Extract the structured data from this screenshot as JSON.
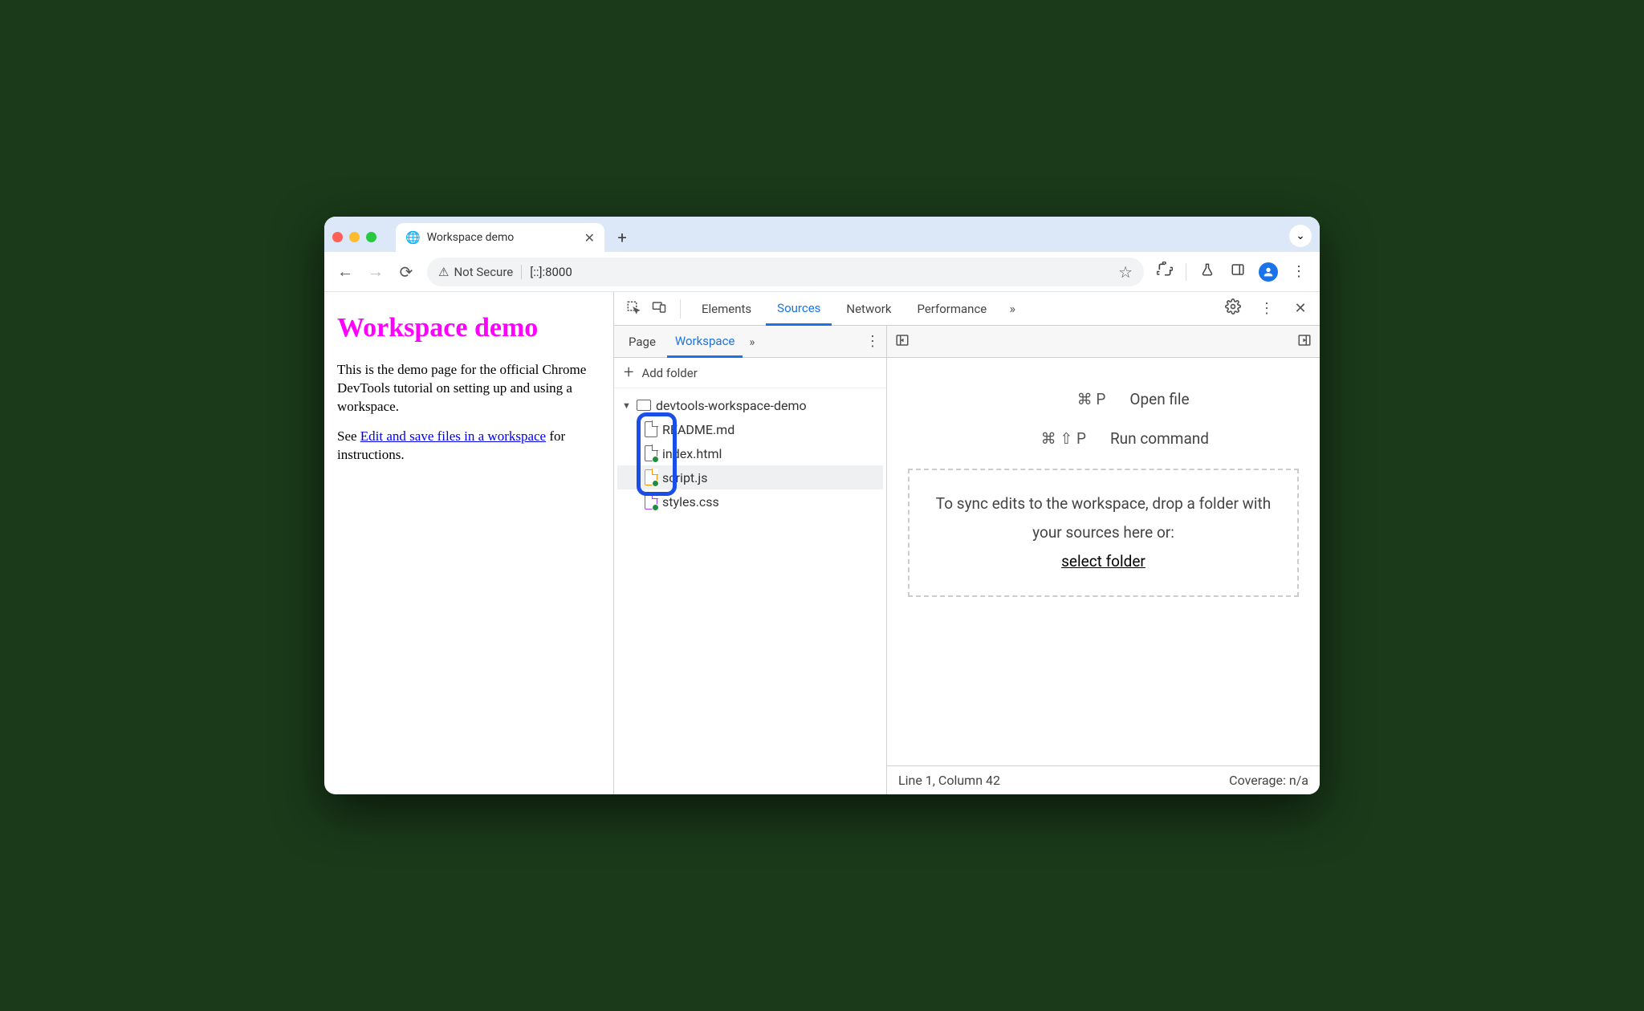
{
  "browser": {
    "tab_title": "Workspace demo",
    "url": "[::]:8000",
    "security_label": "Not Secure"
  },
  "page": {
    "heading": "Workspace demo",
    "p1": "This is the demo page for the official Chrome DevTools tutorial on setting up and using a workspace.",
    "p2_prefix": "See ",
    "p2_link": "Edit and save files in a workspace",
    "p2_suffix": " for instructions."
  },
  "devtools": {
    "tabs": {
      "elements": "Elements",
      "sources": "Sources",
      "network": "Network",
      "performance": "Performance"
    },
    "sources": {
      "subtabs": {
        "page": "Page",
        "workspace": "Workspace"
      },
      "add_folder": "Add folder",
      "folder_name": "devtools-workspace-demo",
      "files": {
        "readme": "README.md",
        "index": "index.html",
        "script": "script.js",
        "styles": "styles.css"
      }
    },
    "hints": {
      "open_file_keys": "⌘ P",
      "open_file_label": "Open file",
      "run_cmd_keys": "⌘ ⇧ P",
      "run_cmd_label": "Run command",
      "drop_text_1": "To sync edits to the workspace, drop a folder with your sources here or:",
      "select_folder": "select folder"
    },
    "status": {
      "cursor": "Line 1, Column 42",
      "coverage": "Coverage: n/a"
    }
  }
}
